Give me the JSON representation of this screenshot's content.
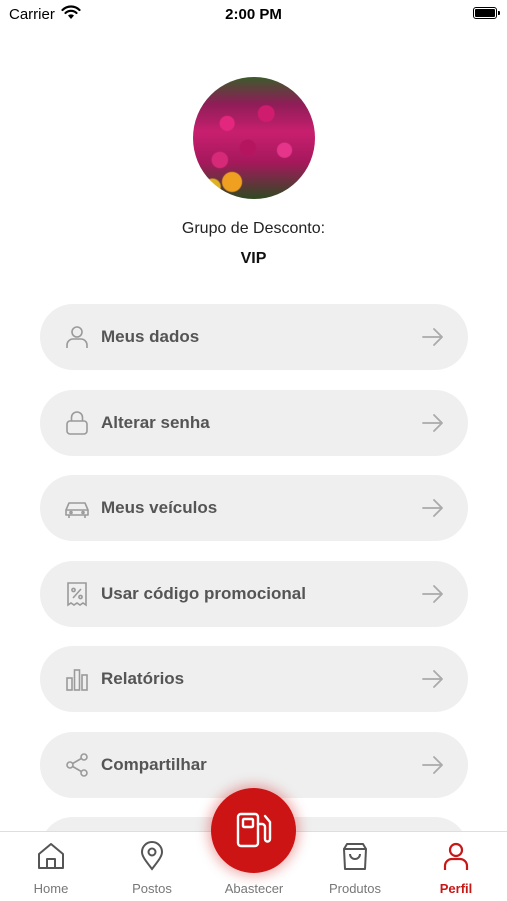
{
  "status_bar": {
    "carrier": "Carrier",
    "time": "2:00 PM"
  },
  "profile": {
    "group_label": "Grupo de Desconto:",
    "group_value": "VIP"
  },
  "menu": [
    {
      "label": "Meus dados",
      "icon": "user-icon"
    },
    {
      "label": "Alterar senha",
      "icon": "lock-icon"
    },
    {
      "label": "Meus veículos",
      "icon": "car-icon"
    },
    {
      "label": "Usar código promocional",
      "icon": "coupon-percent-icon"
    },
    {
      "label": "Relatórios",
      "icon": "bar-chart-icon"
    },
    {
      "label": "Compartilhar",
      "icon": "share-icon"
    }
  ],
  "tabs": [
    {
      "label": "Home",
      "icon": "home-icon"
    },
    {
      "label": "Postos",
      "icon": "location-pin-icon"
    },
    {
      "label": "Abastecer",
      "icon": "fuel-pump-icon"
    },
    {
      "label": "Produtos",
      "icon": "shopping-bag-icon"
    },
    {
      "label": "Perfil",
      "icon": "user-icon",
      "active": true
    }
  ],
  "colors": {
    "accent": "#cc1414",
    "menu_bg": "#efefef",
    "menu_text": "#555555"
  }
}
